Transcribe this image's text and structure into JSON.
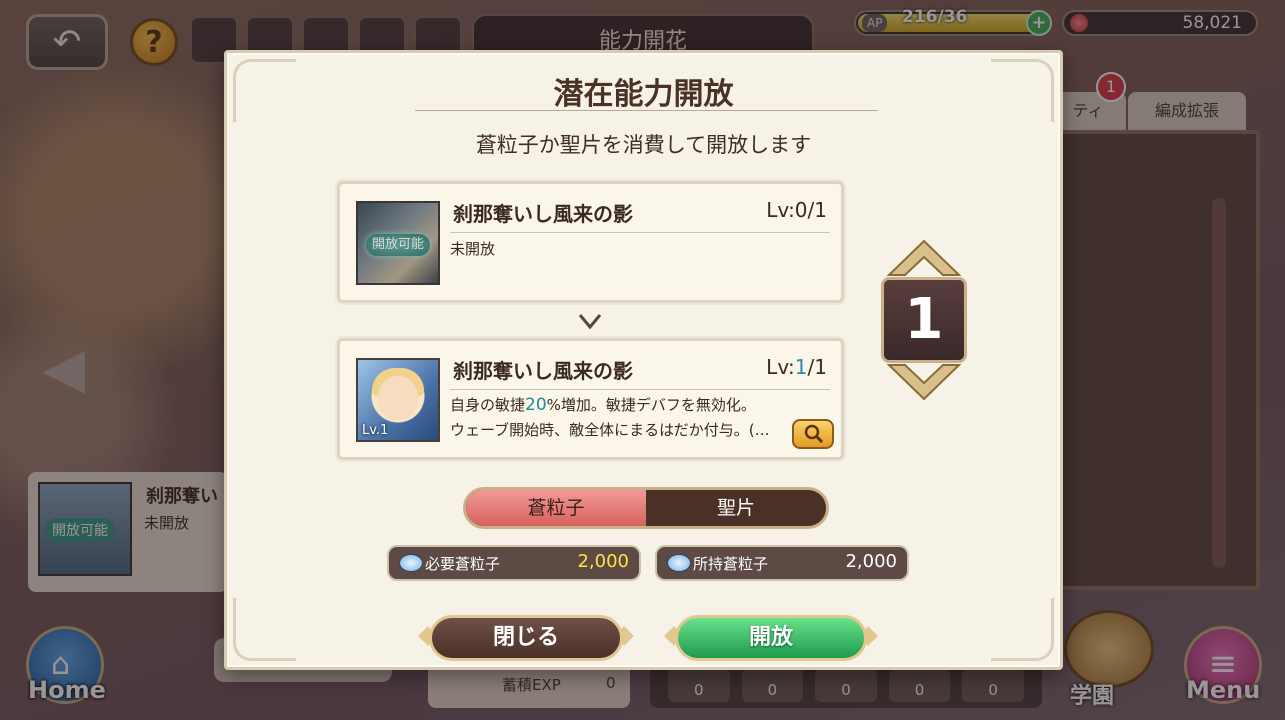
{
  "header": {
    "back_icon": "back-arrow-icon",
    "help_label": "?",
    "screen_title": "能力開花",
    "ap_label": "AP",
    "ap_value": "216/36",
    "ap_fraction": 1.0,
    "gem_value": "58,021"
  },
  "tabs": {
    "party_label": "ティ",
    "formation_label": "編成拡張",
    "notification_count": "1"
  },
  "background_card": {
    "badge": "開放可能",
    "name": "刹那奪い",
    "state": "未開放"
  },
  "bottom_nav": {
    "home_label": "Home",
    "gakuen_label": "学園",
    "menu_label": "Menu",
    "exp_label": "蓄積EXP",
    "exp_value": "0",
    "orb_values": [
      "0",
      "0",
      "0",
      "0",
      "0"
    ]
  },
  "modal": {
    "title": "潜在能力開放",
    "subtitle": "蒼粒子か聖片を消費して開放します",
    "before": {
      "badge": "開放可能",
      "name": "刹那奪いし風来の影",
      "lv": "Lv:0/1",
      "state": "未開放"
    },
    "after": {
      "lv_tag": "Lv.1",
      "name": "刹那奪いし風来の影",
      "lv_prefix": "Lv:",
      "lv_current": "1",
      "lv_suffix": "/1",
      "desc_line1_a": "自身の敏捷",
      "desc_line1_hi": "20",
      "desc_line1_b": "%増加。敏捷デバフを無効化。",
      "desc_line2": "ウェーブ開始時、敵全体にまるはだか付与。(…"
    },
    "counter_value": "1",
    "toggle": {
      "option_a": "蒼粒子",
      "option_b": "聖片"
    },
    "cost": {
      "required_label": "必要蒼粒子",
      "required_value": "2,000",
      "owned_label": "所持蒼粒子",
      "owned_value": "2,000"
    },
    "close_label": "閉じる",
    "open_label": "開放"
  }
}
